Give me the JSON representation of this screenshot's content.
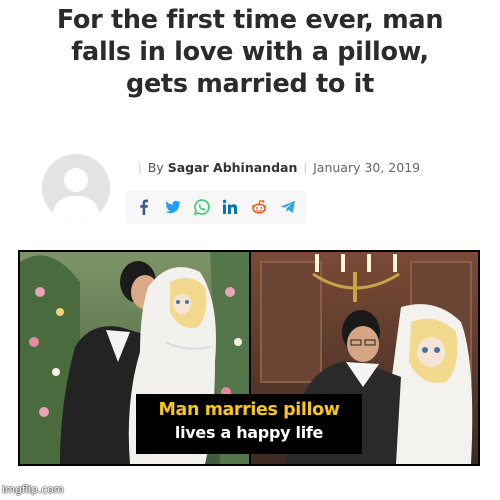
{
  "headline": {
    "line1": "For the first time ever, man",
    "line2": "falls in love with a pillow,",
    "line3": "gets married to it"
  },
  "byline": {
    "by": "By",
    "author": "Sagar Abhinandan",
    "date": "January 30, 2019"
  },
  "share": {
    "icons": [
      "facebook-icon",
      "twitter-icon",
      "whatsapp-icon",
      "linkedin-icon",
      "reddit-icon",
      "telegram-icon"
    ],
    "colors": {
      "facebook": "#3b5998",
      "twitter": "#1da1f2",
      "whatsapp": "#25d366",
      "linkedin": "#0077b5",
      "reddit": "#ff4500",
      "telegram": "#2ca5e0"
    }
  },
  "meme": {
    "caption_line1": "Man marries pillow",
    "caption_line2": "lives a happy life",
    "caption_line1_color": "#f8c614"
  },
  "watermark": "imgflip.com"
}
